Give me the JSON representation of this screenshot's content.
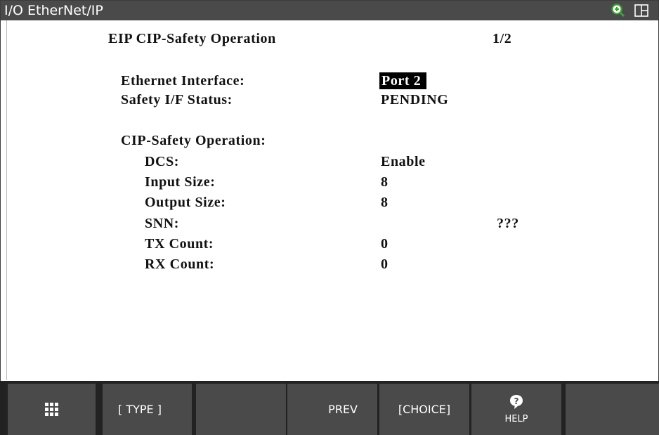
{
  "window": {
    "title": "I/O EtherNet/IP"
  },
  "icons": {
    "zoom": "zoom-in-icon",
    "layout": "split-screen-icon",
    "menu": "menu-grid-icon",
    "help": "help-question-icon"
  },
  "colors": {
    "titlebar": "#4a4a4a",
    "function_key": "#4a4a4a",
    "zoom_accent": "#3aa335",
    "selection": "#000000"
  },
  "screen": {
    "header": "EIP CIP-Safety Operation",
    "page": "1/2",
    "ethernet_interface": {
      "label": "Ethernet Interface:",
      "value": "Port 2"
    },
    "safety_status": {
      "label": "Safety I/F Status:",
      "value": "PENDING"
    },
    "section_title": "CIP-Safety Operation:",
    "items": [
      {
        "label": "DCS:",
        "value": "Enable"
      },
      {
        "label": "Input Size:",
        "value": "8"
      },
      {
        "label": "Output Size:",
        "value": "8"
      },
      {
        "label": "SNN:",
        "value": "???"
      },
      {
        "label": "TX Count:",
        "value": "0"
      },
      {
        "label": "RX Count:",
        "value": "0"
      }
    ]
  },
  "function_keys": {
    "f1": "[ TYPE ]",
    "f2": "",
    "f3": "PREV",
    "f4": "[CHOICE]",
    "help": "HELP",
    "f5": ""
  }
}
